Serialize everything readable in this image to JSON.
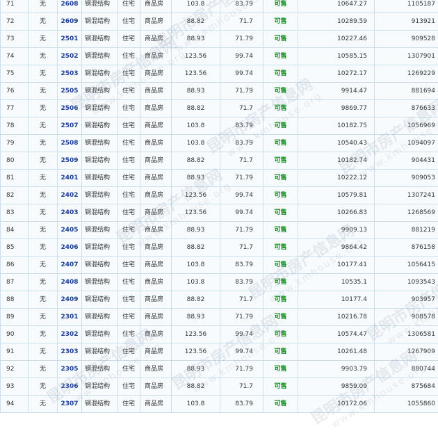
{
  "watermark": {
    "text": "昆明市房产信息网",
    "url": "www.kmhouse.org"
  },
  "colors": {
    "border": "#c9dff0",
    "cell_bg": "#f7fbfe",
    "room_link": "#1a3f9a",
    "status_green": "#0a8a17"
  },
  "rows": [
    {
      "no": "71",
      "decoration": "无",
      "room": "2608",
      "structure": "钢混结构",
      "use": "住宅",
      "type": "商品房",
      "area": "103.8",
      "inner_area": "83.79",
      "status": "可售",
      "unit_price": "10647.27",
      "total": "1105187"
    },
    {
      "no": "72",
      "decoration": "无",
      "room": "2609",
      "structure": "钢混结构",
      "use": "住宅",
      "type": "商品房",
      "area": "88.82",
      "inner_area": "71.7",
      "status": "可售",
      "unit_price": "10289.59",
      "total": "913921"
    },
    {
      "no": "73",
      "decoration": "无",
      "room": "2501",
      "structure": "钢混结构",
      "use": "住宅",
      "type": "商品房",
      "area": "88.93",
      "inner_area": "71.79",
      "status": "可售",
      "unit_price": "10227.46",
      "total": "909528"
    },
    {
      "no": "74",
      "decoration": "无",
      "room": "2502",
      "structure": "钢混结构",
      "use": "住宅",
      "type": "商品房",
      "area": "123.56",
      "inner_area": "99.74",
      "status": "可售",
      "unit_price": "10585.15",
      "total": "1307901"
    },
    {
      "no": "75",
      "decoration": "无",
      "room": "2503",
      "structure": "钢混结构",
      "use": "住宅",
      "type": "商品房",
      "area": "123.56",
      "inner_area": "99.74",
      "status": "可售",
      "unit_price": "10272.17",
      "total": "1269229"
    },
    {
      "no": "76",
      "decoration": "无",
      "room": "2505",
      "structure": "钢混结构",
      "use": "住宅",
      "type": "商品房",
      "area": "88.93",
      "inner_area": "71.79",
      "status": "可售",
      "unit_price": "9914.47",
      "total": "881694"
    },
    {
      "no": "77",
      "decoration": "无",
      "room": "2506",
      "structure": "钢混结构",
      "use": "住宅",
      "type": "商品房",
      "area": "88.82",
      "inner_area": "71.7",
      "status": "可售",
      "unit_price": "9869.77",
      "total": "876633"
    },
    {
      "no": "78",
      "decoration": "无",
      "room": "2507",
      "structure": "钢混结构",
      "use": "住宅",
      "type": "商品房",
      "area": "103.8",
      "inner_area": "83.79",
      "status": "可售",
      "unit_price": "10182.75",
      "total": "1056969"
    },
    {
      "no": "79",
      "decoration": "无",
      "room": "2508",
      "structure": "钢混结构",
      "use": "住宅",
      "type": "商品房",
      "area": "103.8",
      "inner_area": "83.79",
      "status": "可售",
      "unit_price": "10540.43",
      "total": "1094097"
    },
    {
      "no": "80",
      "decoration": "无",
      "room": "2509",
      "structure": "钢混结构",
      "use": "住宅",
      "type": "商品房",
      "area": "88.82",
      "inner_area": "71.7",
      "status": "可售",
      "unit_price": "10182.74",
      "total": "904431"
    },
    {
      "no": "81",
      "decoration": "无",
      "room": "2401",
      "structure": "钢混结构",
      "use": "住宅",
      "type": "商品房",
      "area": "88.93",
      "inner_area": "71.79",
      "status": "可售",
      "unit_price": "10222.12",
      "total": "909053"
    },
    {
      "no": "82",
      "decoration": "无",
      "room": "2402",
      "structure": "钢混结构",
      "use": "住宅",
      "type": "商品房",
      "area": "123.56",
      "inner_area": "99.74",
      "status": "可售",
      "unit_price": "10579.81",
      "total": "1307241"
    },
    {
      "no": "83",
      "decoration": "无",
      "room": "2403",
      "structure": "钢混结构",
      "use": "住宅",
      "type": "商品房",
      "area": "123.56",
      "inner_area": "99.74",
      "status": "可售",
      "unit_price": "10266.83",
      "total": "1268569"
    },
    {
      "no": "84",
      "decoration": "无",
      "room": "2405",
      "structure": "钢混结构",
      "use": "住宅",
      "type": "商品房",
      "area": "88.93",
      "inner_area": "71.79",
      "status": "可售",
      "unit_price": "9909.13",
      "total": "881219"
    },
    {
      "no": "85",
      "decoration": "无",
      "room": "2406",
      "structure": "钢混结构",
      "use": "住宅",
      "type": "商品房",
      "area": "88.82",
      "inner_area": "71.7",
      "status": "可售",
      "unit_price": "9864.42",
      "total": "876158"
    },
    {
      "no": "86",
      "decoration": "无",
      "room": "2407",
      "structure": "钢混结构",
      "use": "住宅",
      "type": "商品房",
      "area": "103.8",
      "inner_area": "83.79",
      "status": "可售",
      "unit_price": "10177.41",
      "total": "1056415"
    },
    {
      "no": "87",
      "decoration": "无",
      "room": "2408",
      "structure": "钢混结构",
      "use": "住宅",
      "type": "商品房",
      "area": "103.8",
      "inner_area": "83.79",
      "status": "可售",
      "unit_price": "10535.1",
      "total": "1093543"
    },
    {
      "no": "88",
      "decoration": "无",
      "room": "2409",
      "structure": "钢混结构",
      "use": "住宅",
      "type": "商品房",
      "area": "88.82",
      "inner_area": "71.7",
      "status": "可售",
      "unit_price": "10177.4",
      "total": "903957"
    },
    {
      "no": "89",
      "decoration": "无",
      "room": "2301",
      "structure": "钢混结构",
      "use": "住宅",
      "type": "商品房",
      "area": "88.93",
      "inner_area": "71.79",
      "status": "可售",
      "unit_price": "10216.78",
      "total": "908578"
    },
    {
      "no": "90",
      "decoration": "无",
      "room": "2302",
      "structure": "钢混结构",
      "use": "住宅",
      "type": "商品房",
      "area": "123.56",
      "inner_area": "99.74",
      "status": "可售",
      "unit_price": "10574.47",
      "total": "1306581"
    },
    {
      "no": "91",
      "decoration": "无",
      "room": "2303",
      "structure": "钢混结构",
      "use": "住宅",
      "type": "商品房",
      "area": "123.56",
      "inner_area": "99.74",
      "status": "可售",
      "unit_price": "10261.48",
      "total": "1267909"
    },
    {
      "no": "92",
      "decoration": "无",
      "room": "2305",
      "structure": "钢混结构",
      "use": "住宅",
      "type": "商品房",
      "area": "88.93",
      "inner_area": "71.79",
      "status": "可售",
      "unit_price": "9903.79",
      "total": "880744"
    },
    {
      "no": "93",
      "decoration": "无",
      "room": "2306",
      "structure": "钢混结构",
      "use": "住宅",
      "type": "商品房",
      "area": "88.82",
      "inner_area": "71.7",
      "status": "可售",
      "unit_price": "9859.09",
      "total": "875684"
    },
    {
      "no": "94",
      "decoration": "无",
      "room": "2307",
      "structure": "钢混结构",
      "use": "住宅",
      "type": "商品房",
      "area": "103.8",
      "inner_area": "83.79",
      "status": "可售",
      "unit_price": "10172.06",
      "total": "1055860"
    }
  ]
}
